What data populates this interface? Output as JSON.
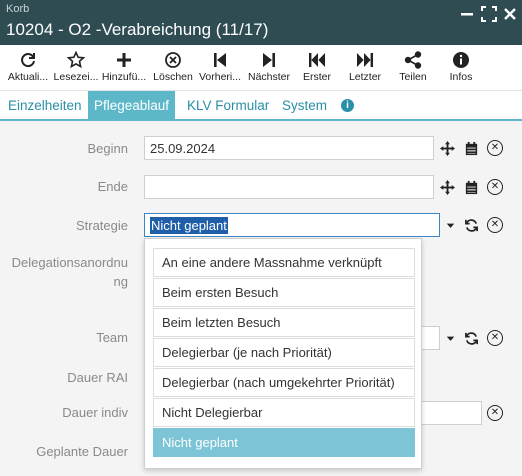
{
  "window": {
    "subtitle": "Korb",
    "title": "10204 - O2 -Verabreichung (11/17)"
  },
  "toolbar": {
    "buttons": [
      {
        "label": "Aktuali...",
        "icon": "refresh-icon"
      },
      {
        "label": "Lesezei...",
        "icon": "star-icon"
      },
      {
        "label": "Hinzufü...",
        "icon": "plus-icon"
      },
      {
        "label": "Löschen",
        "icon": "delete-icon"
      },
      {
        "label": "Vorheri...",
        "icon": "previous-icon"
      },
      {
        "label": "Nächster",
        "icon": "next-icon"
      },
      {
        "label": "Erster",
        "icon": "first-icon"
      },
      {
        "label": "Letzter",
        "icon": "last-icon"
      },
      {
        "label": "Teilen",
        "icon": "share-icon"
      },
      {
        "label": "Infos",
        "icon": "info-icon"
      }
    ]
  },
  "tabs": [
    "Einzelheiten",
    "Pflegeablauf",
    "KLV Formular",
    "System"
  ],
  "active_tab": "Pflegeablauf",
  "form": {
    "beginn_label": "Beginn",
    "beginn_value": "25.09.2024",
    "ende_label": "Ende",
    "ende_value": "",
    "strategie_label": "Strategie",
    "strategie_value": "Nicht geplant",
    "delegation_label_1": "Delegationsanordnu",
    "delegation_label_2": "ng",
    "team_label": "Team",
    "dauer_rai_label": "Dauer RAI",
    "dauer_indiv_label": "Dauer indiv",
    "geplante_dauer_label": "Geplante Dauer"
  },
  "dropdown": {
    "options": [
      "An eine andere Massnahme verknüpft",
      "Beim ersten Besuch",
      "Beim letzten Besuch",
      "Delegierbar (je nach Priorität)",
      "Delegierbar (nach umgekehrter Priorität)",
      "Nicht Delegierbar",
      "Nicht geplant"
    ],
    "selected": "Nicht geplant"
  },
  "colors": {
    "titlebar": "#2e4c52",
    "accent": "#5cb8c8",
    "selected_option": "#7cc4d6",
    "text_selection": "#1f5ea8"
  }
}
